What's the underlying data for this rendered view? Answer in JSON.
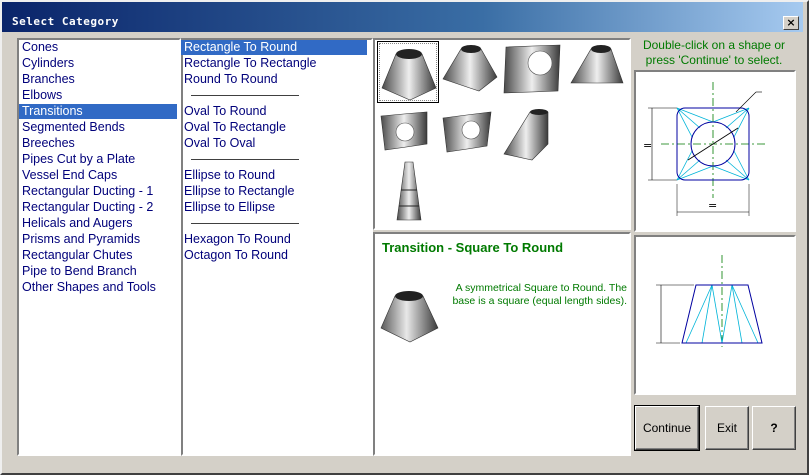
{
  "window": {
    "title": "Select Category",
    "close_glyph": "×"
  },
  "categories": {
    "selected": 4,
    "items": [
      "Cones",
      "Cylinders",
      "Branches",
      "Elbows",
      "Transitions",
      "Segmented Bends",
      "Breeches",
      "Pipes Cut by a Plate",
      "Vessel End Caps",
      "Rectangular Ducting - 1",
      "Rectangular Ducting - 2",
      "Helicals and Augers",
      "Prisms and Pyramids",
      "Rectangular Chutes",
      "Pipe to Bend Branch",
      "Other Shapes and Tools"
    ]
  },
  "subtypes": {
    "selected": 0,
    "groups": [
      [
        "Rectangle To Round",
        "Rectangle To Rectangle",
        "Round To Round"
      ],
      [
        "Oval To Round",
        "Oval To Rectangle",
        "Oval To Oval"
      ],
      [
        "Ellipse to Round",
        "Ellipse to Rectangle",
        "Ellipse to Ellipse"
      ],
      [
        "Hexagon To Round",
        "Octagon To Round"
      ]
    ]
  },
  "gallery": {
    "selected": 0,
    "shapes": [
      "square-to-round-icon",
      "rect-to-round-icon",
      "square-hole-plate-icon",
      "round-to-round-icon",
      "flat-oval-to-round-icon",
      "oval-plate-icon",
      "offset-transition-icon",
      "segmented-tower-icon"
    ]
  },
  "hint": "Double-click on a shape or press 'Continue' to select.",
  "description": {
    "title": "Transition - Square To Round",
    "text": "A symmetrical Square to Round. The base is a square (equal length sides)."
  },
  "dimensions": {
    "label_a": "=",
    "label_b": "="
  },
  "buttons": {
    "continue": "Continue",
    "exit": "Exit",
    "help": "?"
  },
  "colors": {
    "selection": "#316ac5",
    "list_text": "#00007a",
    "accent_green": "#007a00",
    "sketch_cyan": "#00b4d8"
  }
}
